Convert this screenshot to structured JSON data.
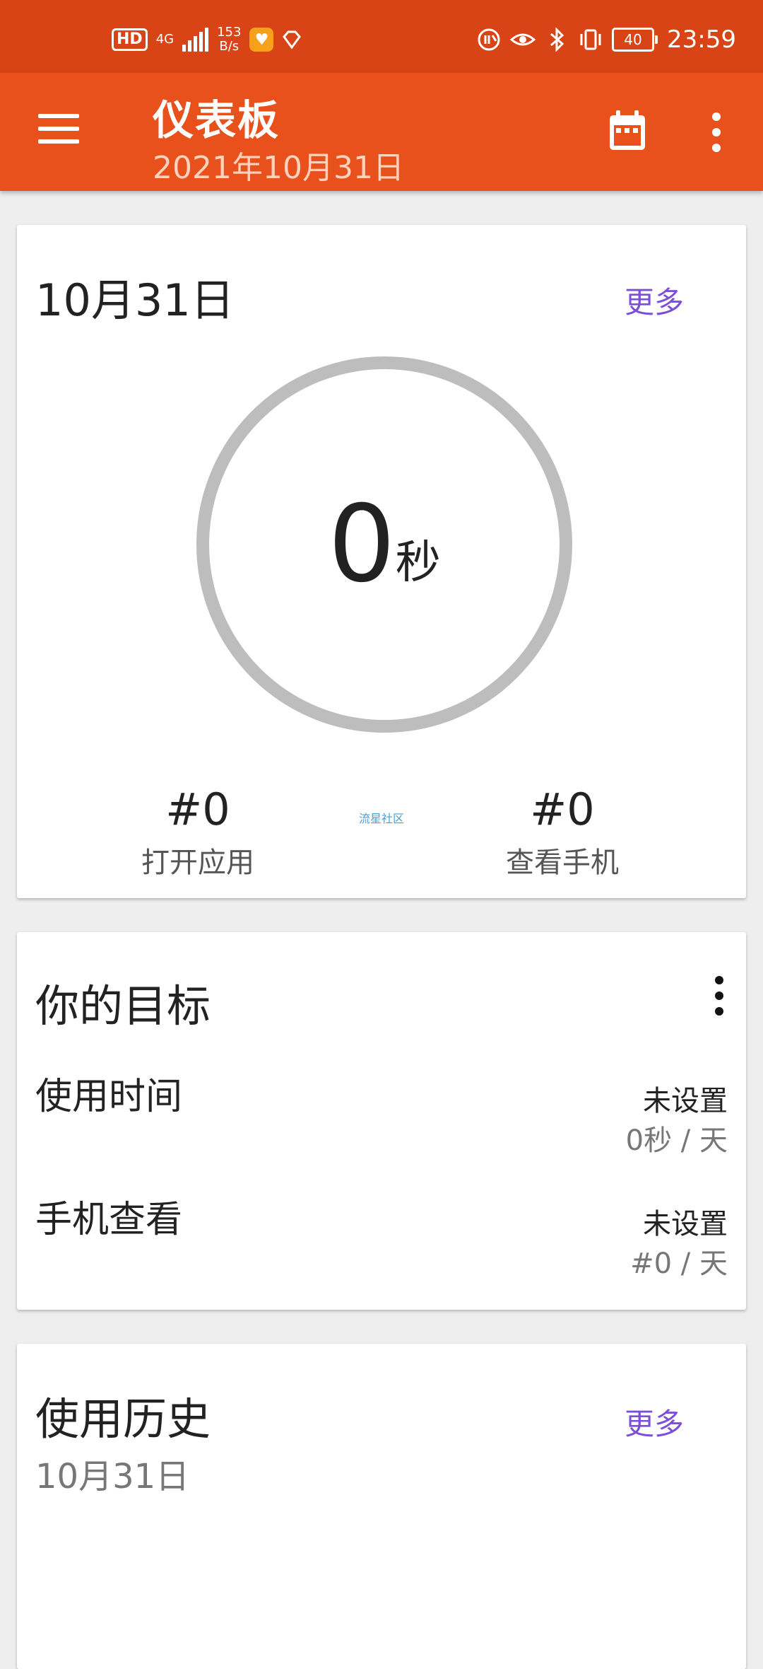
{
  "status_bar": {
    "hd": "HD",
    "network": "4G",
    "speed_value": "153",
    "speed_unit": "B/s",
    "battery": "40",
    "time": "23:59"
  },
  "app_bar": {
    "title": "仪表板",
    "subtitle": "2021年10月31日"
  },
  "today_card": {
    "date": "10月31日",
    "more": "更多",
    "usage_value": "0",
    "usage_unit": "秒",
    "opens_value": "#0",
    "opens_label": "打开应用",
    "checks_value": "#0",
    "checks_label": "查看手机",
    "watermark": "流星社区"
  },
  "goals_card": {
    "title": "你的目标",
    "goals": [
      {
        "label": "使用时间",
        "status": "未设置",
        "value": "0秒 / 天"
      },
      {
        "label": "手机查看",
        "status": "未设置",
        "value": "#0 / 天"
      }
    ]
  },
  "history_card": {
    "title": "使用历史",
    "date": "10月31日",
    "more": "更多"
  },
  "colors": {
    "status_bar": "#d94417",
    "app_bar": "#e8501c",
    "accent_link": "#7b4fd8",
    "ring": "#bdbdbd"
  }
}
